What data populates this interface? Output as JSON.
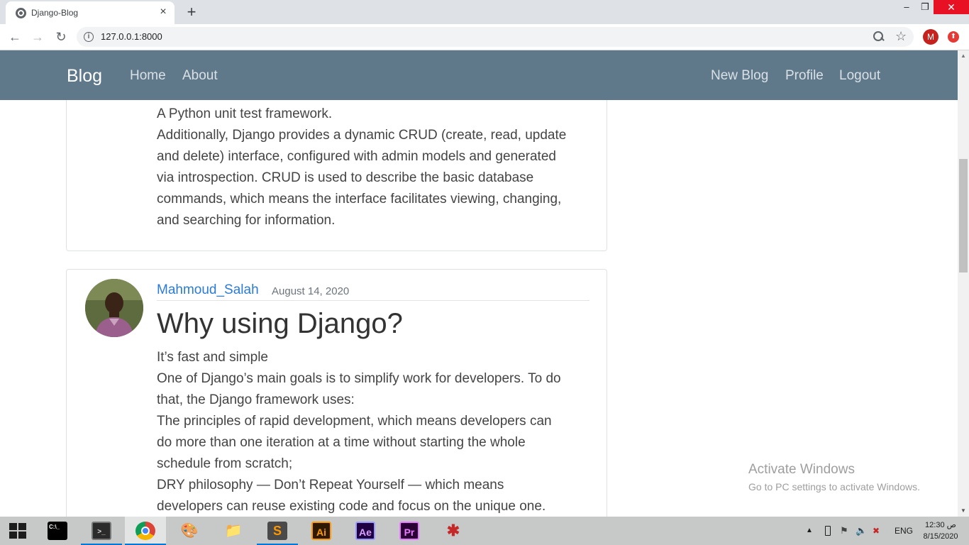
{
  "browser": {
    "tab_title": "Django-Blog",
    "url": "127.0.0.1:8000",
    "avatar_letter": "M"
  },
  "navbar": {
    "brand": "Blog",
    "left_links": [
      "Home",
      "About"
    ],
    "right_links": [
      "New Blog",
      "Profile",
      "Logout"
    ]
  },
  "posts": [
    {
      "lines": [
        "A Python unit test framework.",
        "Additionally, Django provides a dynamic CRUD (create, read, update",
        "and delete) interface, configured with admin models and generated",
        "via introspection. CRUD is used to describe the basic database",
        "commands, which means the interface facilitates viewing, changing,",
        "and searching for information."
      ]
    },
    {
      "author": "Mahmoud_Salah",
      "date": "August 14, 2020",
      "title": "Why using Django?",
      "lines": [
        "It’s fast and simple",
        "One of Django’s main goals is to simplify work for developers. To do",
        "that, the Django framework uses:",
        "The principles of rapid development, which means developers can",
        "do more than one iteration at a time without starting the whole",
        "schedule from scratch;",
        "DRY philosophy — Don’t Repeat Yourself — which means",
        "developers can reuse existing code and focus on the unique one."
      ]
    }
  ],
  "watermark": {
    "title": "Activate Windows",
    "subtitle": "Go to PC settings to activate Windows."
  },
  "taskbar": {
    "apps": [
      {
        "name": "cmd",
        "glyph": "C:\\_"
      },
      {
        "name": "terminal",
        "glyph": ">_"
      },
      {
        "name": "chrome",
        "glyph": ""
      },
      {
        "name": "paint",
        "glyph": "🎨"
      },
      {
        "name": "file-explorer",
        "glyph": "📁"
      },
      {
        "name": "sublime-text",
        "glyph": "S"
      },
      {
        "name": "illustrator",
        "glyph": "Ai"
      },
      {
        "name": "after-effects",
        "glyph": "Ae"
      },
      {
        "name": "premiere",
        "glyph": "Pr"
      },
      {
        "name": "spider-app",
        "glyph": "✱"
      }
    ],
    "language": "ENG",
    "time": "12:30 ص",
    "date": "8/15/2020"
  },
  "colors": {
    "navbar": "#5f788a",
    "link": "#2b7bd5"
  }
}
